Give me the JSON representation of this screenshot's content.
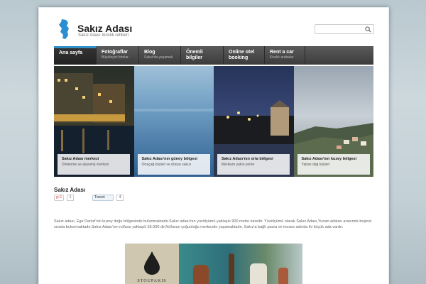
{
  "site": {
    "title": "Sakız Adası",
    "subtitle": "Sakız Adası türistik rehberi"
  },
  "nav": {
    "items": [
      {
        "label": "Ana sayfa",
        "sub": ""
      },
      {
        "label": "Fotoğraflar",
        "sub": "Büyüleyici fotolar"
      },
      {
        "label": "Blog",
        "sub": "Sakız'da yaşamak"
      },
      {
        "label": "Önemli bilgiler",
        "sub": ""
      },
      {
        "label": "Online otel booking",
        "sub": ""
      },
      {
        "label": "Rent a car",
        "sub": "Kiralık arabalar"
      }
    ]
  },
  "slides": [
    {
      "title": "Sakız Adası merkezi",
      "sub": "Dinlenme ve alışveriş merkezi"
    },
    {
      "title": "Sakız Adası'nın güney bölgesi",
      "sub": "Ortaçağ köyleri ve dünya sakızı"
    },
    {
      "title": "Sakız Adası'nın orta bölgesi",
      "sub": "Merkeze yakın yerler"
    },
    {
      "title": "Sakız Adası'nın kuzey bölgesi",
      "sub": "Yaban dağ köyleri"
    }
  ],
  "content": {
    "title": "Sakız Adası",
    "gplus_label": "g+1",
    "gplus_count": "1",
    "tweet_label": "Tweet",
    "tweet_count": "4",
    "paragraph": "Sakız adası, Ege Denizi'nin kuzey doğu bölgesinde bulunmaktadır.Sakız adası'nın yüzölçümü yaklaşık 900 metre karedir. Yüzölçümü olarak Sakız Adası,Yunan adaları arasında beşinci sırada bulunmaktadır.Sakız Adası'nın nüfusu yaklaşık 55.000 dir.Nüfusun çoğunluğu merkezde yaşamaktadır. Sakız'a bağlı psara ve inuses adında iki küçük ada vardır.",
    "promo_brand": "STOUPAKIS"
  },
  "colors": {
    "nav_active_accent": "#2f8fc7",
    "nav_bg": "#4a4a4a",
    "logo": "#2a8fd0"
  }
}
